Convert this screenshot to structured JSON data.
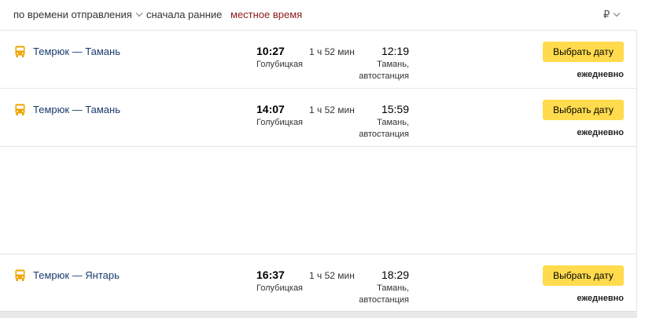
{
  "filters": {
    "sort": "по времени отправления",
    "order": "сначала ранние",
    "timezone": "местное время",
    "currency": "₽"
  },
  "trips": [
    {
      "route": "Темрюк — Тамань",
      "dep_time": "10:27",
      "dep_station": "Голубицкая",
      "duration": "1 ч 52 мин",
      "arr_time": "12:19",
      "arr_station_line1": "Тамань,",
      "arr_station_line2": "автостанция",
      "button": "Выбрать дату",
      "frequency": "ежедневно"
    },
    {
      "route": "Темрюк — Тамань",
      "dep_time": "14:07",
      "dep_station": "Голубицкая",
      "duration": "1 ч 52 мин",
      "arr_time": "15:59",
      "arr_station_line1": "Тамань,",
      "arr_station_line2": "автостанция",
      "button": "Выбрать дату",
      "frequency": "ежедневно"
    },
    {
      "route": "Темрюк — Янтарь",
      "dep_time": "16:37",
      "dep_station": "Голубицкая",
      "duration": "1 ч 52 мин",
      "arr_time": "18:29",
      "arr_station_line1": "Тамань,",
      "arr_station_line2": "автостанция",
      "button": "Выбрать дату",
      "frequency": "ежедневно"
    }
  ],
  "colors": {
    "accent_button": "#ffdb4d",
    "route_link": "#1a3c6e",
    "timezone_text": "#8b1a1a",
    "bus_icon": "#f0a500"
  },
  "icons": {
    "bus": "bus-icon",
    "chevron": "chevron-down-icon"
  }
}
